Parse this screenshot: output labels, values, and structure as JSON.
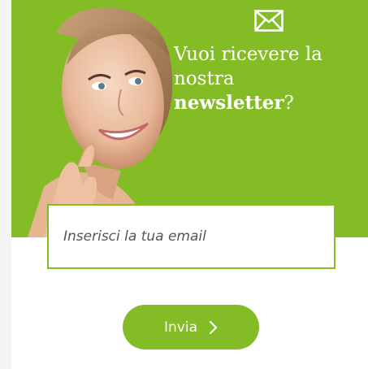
{
  "colors": {
    "accent": "#84bc25",
    "text_on_accent": "#ffffff",
    "input_text": "#555555"
  },
  "banner": {
    "icon": "envelope-icon",
    "headline": {
      "line1": "Vuoi ricevere la",
      "line2": "nostra",
      "line3_bold": "newsletter",
      "line3_rest": "?"
    }
  },
  "form": {
    "email_placeholder": "Inserisci la tua email",
    "email_value": "",
    "submit_label": "Invia",
    "submit_icon": "chevron-right-icon"
  }
}
